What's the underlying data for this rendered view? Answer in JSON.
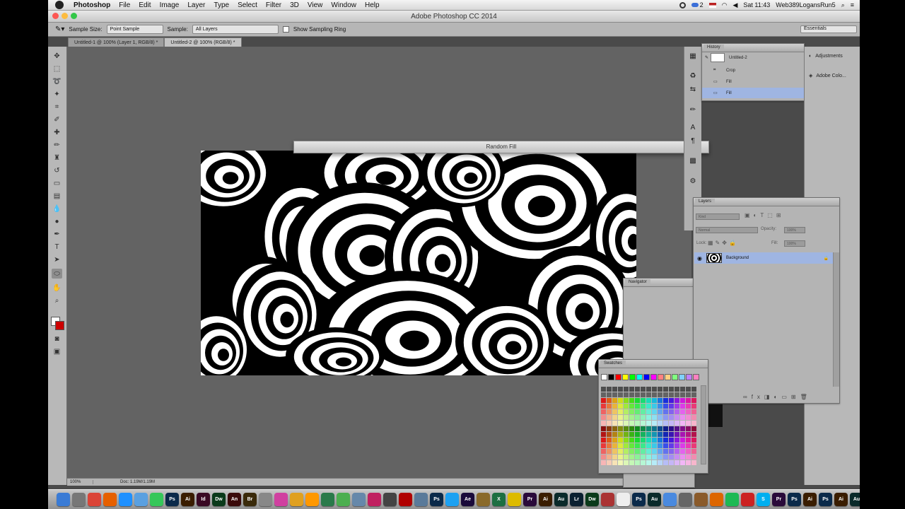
{
  "menubar": {
    "app_name": "Photoshop",
    "items": [
      "File",
      "Edit",
      "Image",
      "Layer",
      "Type",
      "Select",
      "Filter",
      "3D",
      "View",
      "Window",
      "Help"
    ],
    "status": {
      "badge_count": "2",
      "clock": "Sat 11:43",
      "user": "Web389LogansRun5"
    }
  },
  "window": {
    "title": "Adobe Photoshop CC 2014"
  },
  "options_bar": {
    "sample_size_label": "Sample Size:",
    "sample_size_value": "Point Sample",
    "sample_label": "Sample:",
    "sample_value": "All Layers",
    "sampling_ring_label": "Show Sampling Ring",
    "workspace": "Essentials"
  },
  "tabs": [
    {
      "label": "Untitled-1 @ 100% (Layer 1, RGB/8) *"
    },
    {
      "label": "Untitled-2 @ 100% (RGB/8) *"
    }
  ],
  "dialog": {
    "title": "Random Fill"
  },
  "doc_status": {
    "zoom": "100%",
    "doc": "Doc: 1.19M/1.19M"
  },
  "history": {
    "tab": "History",
    "snapshot": "Untitled-2",
    "states": [
      "Crop",
      "Fill",
      "Fill"
    ]
  },
  "side_panel": {
    "items": [
      "Adjustments",
      "Adobe Colo..."
    ]
  },
  "layers": {
    "tab": "Layers",
    "filter_kind": "Kind",
    "blend_mode": "Normal",
    "opacity_label": "Opacity:",
    "opacity_value": "100%",
    "lock_label": "Lock:",
    "fill_label": "Fill:",
    "fill_value": "100%",
    "layer_name": "Background"
  },
  "navigator": {
    "tab": "Navigator"
  },
  "swatches": {
    "tab": "Swatches",
    "top_row": [
      "#ffffff",
      "#000000",
      "#ff0000",
      "#ffff00",
      "#00ff00",
      "#00ffff",
      "#0000ff",
      "#ff00ff",
      "#ff8080",
      "#ffd080",
      "#80ff80",
      "#80d0ff",
      "#c080ff",
      "#ff80c0"
    ]
  },
  "dock": {
    "icons": [
      {
        "name": "finder-icon",
        "label": "",
        "color": "#3a7bd5"
      },
      {
        "name": "launchpad-icon",
        "label": "",
        "color": "#777777"
      },
      {
        "name": "chrome-icon",
        "label": "",
        "color": "#db4437"
      },
      {
        "name": "firefox-icon",
        "label": "",
        "color": "#e66000"
      },
      {
        "name": "safari-icon",
        "label": "",
        "color": "#1e90ff"
      },
      {
        "name": "mail-icon",
        "label": "",
        "color": "#5aa0e0"
      },
      {
        "name": "messages-icon",
        "label": "",
        "color": "#35c759"
      },
      {
        "name": "ps-icon",
        "label": "Ps",
        "color": "#0b2a4a"
      },
      {
        "name": "ai-icon",
        "label": "Ai",
        "color": "#3a1d00"
      },
      {
        "name": "id-icon",
        "label": "Id",
        "color": "#3a0a24"
      },
      {
        "name": "dw-icon",
        "label": "Dw",
        "color": "#0a3a1a"
      },
      {
        "name": "an-icon",
        "label": "An",
        "color": "#3a0a0a"
      },
      {
        "name": "br-icon",
        "label": "Br",
        "color": "#3a2a0a"
      },
      {
        "name": "settings-icon",
        "label": "",
        "color": "#888888"
      },
      {
        "name": "itunes-icon",
        "label": "",
        "color": "#d040a0"
      },
      {
        "name": "sketch-icon",
        "label": "",
        "color": "#e0a020"
      },
      {
        "name": "photos-icon",
        "label": "",
        "color": "#ff9800"
      },
      {
        "name": "globe-icon",
        "label": "",
        "color": "#2a7a4a"
      },
      {
        "name": "maps-icon",
        "label": "",
        "color": "#4caf50"
      },
      {
        "name": "finder2-icon",
        "label": "",
        "color": "#6688aa"
      },
      {
        "name": "music-icon",
        "label": "",
        "color": "#c02060"
      },
      {
        "name": "camera-icon",
        "label": "",
        "color": "#444444"
      },
      {
        "name": "acrobat-icon",
        "label": "",
        "color": "#b00000"
      },
      {
        "name": "preview-icon",
        "label": "",
        "color": "#5a7a9a"
      },
      {
        "name": "ps2-icon",
        "label": "Ps",
        "color": "#0b2a4a"
      },
      {
        "name": "tw-icon",
        "label": "",
        "color": "#1da1f2"
      },
      {
        "name": "ae-icon",
        "label": "Ae",
        "color": "#1a0a3a"
      },
      {
        "name": "bridge-icon",
        "label": "",
        "color": "#8a6a2a"
      },
      {
        "name": "excel-icon",
        "label": "X",
        "color": "#1d6f42"
      },
      {
        "name": "pen-icon",
        "label": "",
        "color": "#ddbb00"
      },
      {
        "name": "pr-icon",
        "label": "Pr",
        "color": "#2a0a3a"
      },
      {
        "name": "ai2-icon",
        "label": "Ai",
        "color": "#3a1d00"
      },
      {
        "name": "au-icon",
        "label": "Au",
        "color": "#0a2a2a"
      },
      {
        "name": "lr-icon",
        "label": "Lr",
        "color": "#0a2030"
      },
      {
        "name": "dw2-icon",
        "label": "Dw",
        "color": "#0a3a1a"
      },
      {
        "name": "an2-icon",
        "label": "",
        "color": "#aa3333"
      },
      {
        "name": "calendar-icon",
        "label": "",
        "color": "#eeeeee"
      },
      {
        "name": "ps3-icon",
        "label": "Ps",
        "color": "#0b2a4a"
      },
      {
        "name": "audition-icon",
        "label": "Au",
        "color": "#0a2a2a"
      },
      {
        "name": "tb-icon",
        "label": "",
        "color": "#4a8adf"
      },
      {
        "name": "media-icon",
        "label": "",
        "color": "#666666"
      },
      {
        "name": "book-icon",
        "label": "",
        "color": "#8a5a2a"
      },
      {
        "name": "fox-icon",
        "label": "",
        "color": "#dd6600"
      },
      {
        "name": "spotify-icon",
        "label": "",
        "color": "#1db954"
      },
      {
        "name": "cc-icon",
        "label": "",
        "color": "#cc2222"
      },
      {
        "name": "skype-icon",
        "label": "S",
        "color": "#00aff0"
      },
      {
        "name": "pr2-icon",
        "label": "Pr",
        "color": "#2a0a3a"
      },
      {
        "name": "ps4-icon",
        "label": "Ps",
        "color": "#0b2a4a"
      },
      {
        "name": "ai3-icon",
        "label": "Ai",
        "color": "#3a1d00"
      },
      {
        "name": "ps5-icon",
        "label": "Ps",
        "color": "#0b2a4a"
      },
      {
        "name": "ai4-icon",
        "label": "Ai",
        "color": "#3a1d00"
      },
      {
        "name": "au2-icon",
        "label": "Au",
        "color": "#0a2a2a"
      }
    ]
  },
  "colors": {
    "selection": "#9fb5e2",
    "canvas_bg": "#636363",
    "foreground": "#ffffff",
    "background": "#cc0000"
  }
}
